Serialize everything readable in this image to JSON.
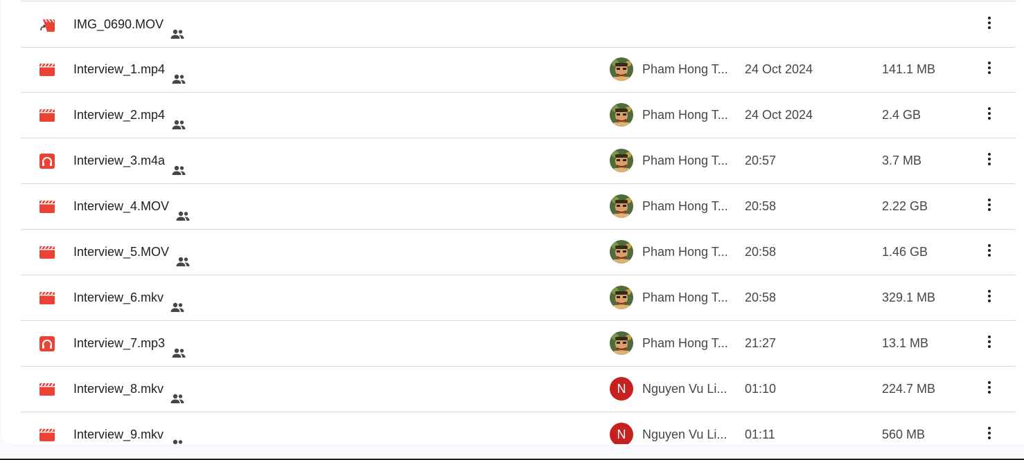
{
  "colors": {
    "accent_red": "#ea4335",
    "text_primary": "#1f1f1f",
    "text_secondary": "#444746",
    "divider": "#dadce0"
  },
  "files": [
    {
      "name": "IMG_0690.MOV",
      "icon": "video-shortcut-icon",
      "owner": "",
      "avatar": "",
      "modified": "",
      "size": ""
    },
    {
      "name": "Interview_1.mp4",
      "icon": "video-file-icon",
      "owner": "Pham Hong T...",
      "avatar": "photo",
      "modified": "24 Oct 2024",
      "size": "141.1 MB"
    },
    {
      "name": "Interview_2.mp4",
      "icon": "video-file-icon",
      "owner": "Pham Hong T...",
      "avatar": "photo",
      "modified": "24 Oct 2024",
      "size": "2.4 GB"
    },
    {
      "name": "Interview_3.m4a",
      "icon": "audio-file-icon",
      "owner": "Pham Hong T...",
      "avatar": "photo",
      "modified": "20:57",
      "size": "3.7 MB"
    },
    {
      "name": "Interview_4.MOV",
      "icon": "video-file-icon",
      "owner": "Pham Hong T...",
      "avatar": "photo",
      "modified": "20:58",
      "size": "2.22 GB"
    },
    {
      "name": "Interview_5.MOV",
      "icon": "video-file-icon",
      "owner": "Pham Hong T...",
      "avatar": "photo",
      "modified": "20:58",
      "size": "1.46 GB"
    },
    {
      "name": "Interview_6.mkv",
      "icon": "video-file-icon",
      "owner": "Pham Hong T...",
      "avatar": "photo",
      "modified": "20:58",
      "size": "329.1 MB"
    },
    {
      "name": "Interview_7.mp3",
      "icon": "audio-file-icon",
      "owner": "Pham Hong T...",
      "avatar": "photo",
      "modified": "21:27",
      "size": "13.1 MB"
    },
    {
      "name": "Interview_8.mkv",
      "icon": "video-file-icon",
      "owner": "Nguyen Vu Li...",
      "avatar": "N",
      "modified": "01:10",
      "size": "224.7 MB"
    },
    {
      "name": "Interview_9.mkv",
      "icon": "video-file-icon",
      "owner": "Nguyen Vu Li...",
      "avatar": "N",
      "modified": "01:11",
      "size": "560 MB"
    }
  ]
}
